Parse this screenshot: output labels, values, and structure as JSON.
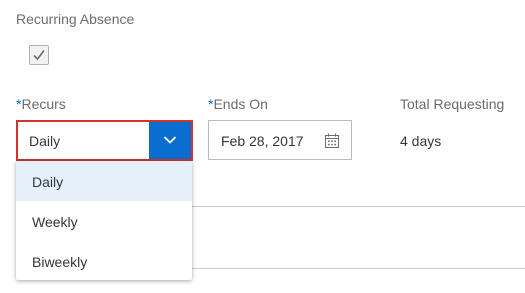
{
  "recurring_absence": {
    "label": "Recurring Absence",
    "checked": true
  },
  "recurs": {
    "required_marker": "*",
    "label": "Recurs",
    "value": "Daily",
    "options": [
      "Daily",
      "Weekly",
      "Biweekly"
    ],
    "highlighted_option": "Daily",
    "dropdown_open": true,
    "state": "error"
  },
  "ends_on": {
    "required_marker": "*",
    "label": "Ends On",
    "value": "Feb 28, 2017",
    "icon": "calendar-icon"
  },
  "total_requesting": {
    "label": "Total Requesting",
    "value": "4 days"
  },
  "colors": {
    "accent": "#0a6ed1",
    "error_border": "#d0342c",
    "selected_option_bg": "#e5f0fa",
    "label_text": "#6a6d70"
  }
}
